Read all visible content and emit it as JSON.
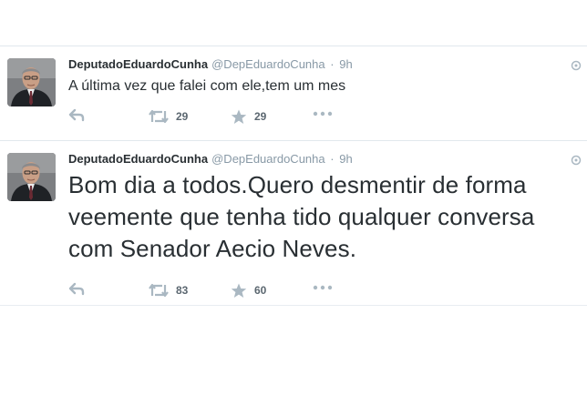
{
  "tweets": [
    {
      "fullname": "DeputadoEduardoCunha",
      "handle": "@DepEduardoCunha",
      "separator": "·",
      "time": "9h",
      "text": "A última vez que falei com ele,tem um mes",
      "retweets": "29",
      "favorites": "29"
    },
    {
      "fullname": "DeputadoEduardoCunha",
      "handle": "@DepEduardoCunha",
      "separator": "·",
      "time": "9h",
      "text": "Bom dia a todos.Quero desmentir de forma veemente que tenha tido qualquer conversa com Senador Aecio Neves.",
      "retweets": "83",
      "favorites": "60"
    }
  ],
  "colors": {
    "text": "#292f33",
    "muted": "#8899a6",
    "icon": "#aab8c2",
    "divider": "#e1e8ed"
  },
  "icons": [
    "reply-icon",
    "retweet-icon",
    "favorite-star-icon",
    "more-dots-icon",
    "caret-icon"
  ]
}
